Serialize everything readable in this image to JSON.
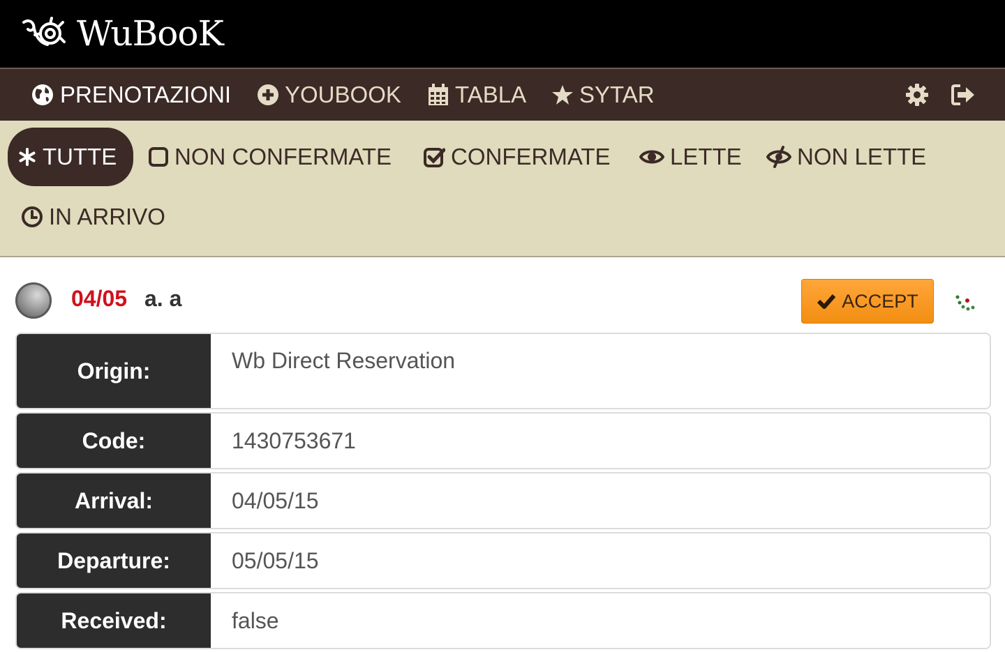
{
  "app": {
    "brand_name": "WuBooK"
  },
  "nav": {
    "items": [
      {
        "label": "PRENOTAZIONI",
        "icon": "globe-icon"
      },
      {
        "label": "YOUBOOK",
        "icon": "plus-circle-icon"
      },
      {
        "label": "TABLA",
        "icon": "calendar-icon"
      },
      {
        "label": "SYTAR",
        "icon": "star-icon"
      }
    ],
    "settings_icon": "gear-icon",
    "logout_icon": "logout-icon"
  },
  "filters": {
    "items": [
      {
        "label": "TUTTE",
        "icon": "asterisk-icon"
      },
      {
        "label": "NON CONFERMATE",
        "icon": "square-icon"
      },
      {
        "label": "CONFERMATE",
        "icon": "check-square-icon"
      },
      {
        "label": "LETTE",
        "icon": "eye-icon"
      },
      {
        "label": "NON LETTE",
        "icon": "eye-slash-icon"
      },
      {
        "label": "IN ARRIVO",
        "icon": "clock-icon"
      }
    ]
  },
  "booking": {
    "date": "04/05",
    "name": "a. a",
    "accept_label": "ACCEPT",
    "fields": [
      {
        "label": "Origin:",
        "value": "Wb Direct Reservation"
      },
      {
        "label": "Code:",
        "value": "1430753671"
      },
      {
        "label": "Arrival:",
        "value": "04/05/15"
      },
      {
        "label": "Departure:",
        "value": "05/05/15"
      },
      {
        "label": "Received:",
        "value": "false"
      }
    ]
  },
  "colors": {
    "topbar": "#000000",
    "navbar": "#3c2a26",
    "filterbar": "#dfdbbc",
    "accent_orange": "#f7931e",
    "date_red": "#d0111b"
  }
}
